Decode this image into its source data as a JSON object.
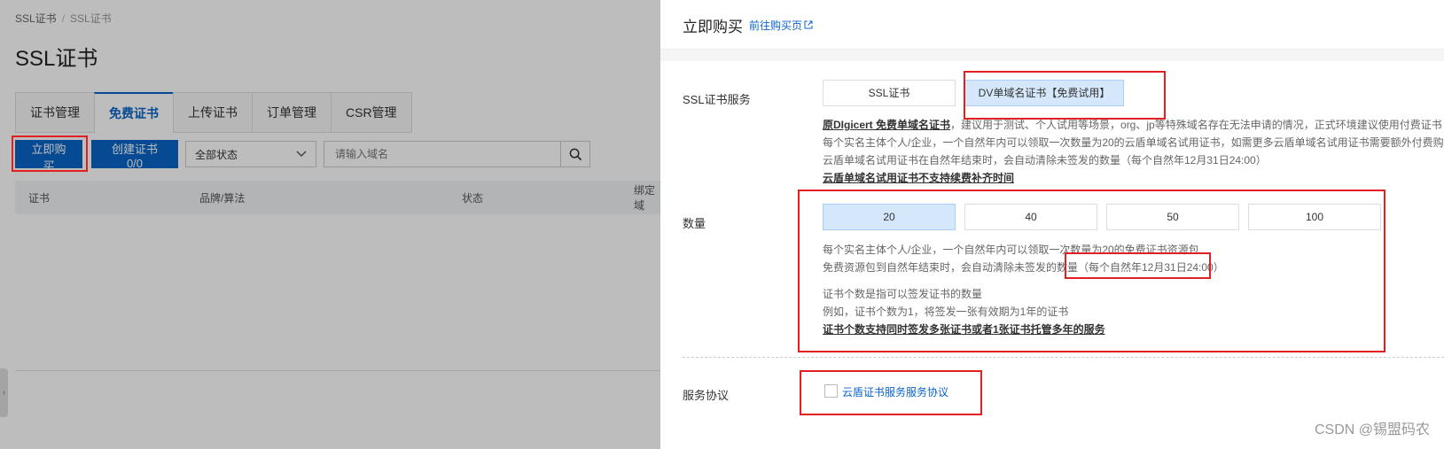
{
  "breadcrumb": [
    "SSL证书",
    "SSL证书"
  ],
  "page_title": "SSL证书",
  "tabs": [
    {
      "label": "证书管理",
      "active": false
    },
    {
      "label": "免费证书",
      "active": true
    },
    {
      "label": "上传证书",
      "active": false
    },
    {
      "label": "订单管理",
      "active": false
    },
    {
      "label": "CSR管理",
      "active": false
    }
  ],
  "toolbar": {
    "buy_label": "立即购买",
    "create_label": "创建证书 0/0",
    "status_select": "全部状态",
    "search_placeholder": "请输入域名"
  },
  "table": {
    "headers": [
      "证书",
      "品牌/算法",
      "状态",
      "绑定域"
    ]
  },
  "drawer": {
    "title": "立即购买",
    "link": "前往购买页",
    "service_label": "SSL证书服务",
    "service_options": [
      {
        "label": "SSL证书",
        "selected": false
      },
      {
        "label": "DV单域名证书【免费试用】",
        "selected": true
      }
    ],
    "service_desc": {
      "line1_bold": "原DIgicert 免费单域名证书",
      "line1_rest": "，建议用于测试、个人试用等场景，org、jp等特殊域名存在无法申请的情况，正式环境建议使用付费证书",
      "line2": "每个实名主体个人/企业，一个自然年内可以领取一次数量为20的云盾单域名试用证书，如需更多云盾单域名试用证书需要额外付费购",
      "line3": "云盾单域名试用证书在自然年结束时，会自动清除未签发的数量（每个自然年12月31日24:00）",
      "line4_bold": "云盾单域名试用证书不支持续费补齐时间"
    },
    "quantity_label": "数量",
    "quantity_options": [
      {
        "label": "20",
        "selected": true
      },
      {
        "label": "40",
        "selected": false
      },
      {
        "label": "50",
        "selected": false
      },
      {
        "label": "100",
        "selected": false
      }
    ],
    "quantity_desc": {
      "line1": "每个实名主体个人/企业，一个自然年内可以领取一次数量为20的免费证书资源包",
      "line2": "免费资源包到自然年结束时，会自动清除未签发的数量（每个自然年12月31日24:00）",
      "line3": "证书个数是指可以签发证书的数量",
      "line4": "例如，证书个数为1，将签发一张有效期为1年的证书",
      "line5_bold": "证书个数支持同时签发多张证书或者1张证书托管多年的服务"
    },
    "agreement_label": "服务协议",
    "agreement_link": "云盾证书服务服务协议"
  },
  "watermark": "CSDN @锡盟码农",
  "colors": {
    "primary": "#0a64c8",
    "highlight": "#e32020",
    "selected_bg": "#d5e7fa"
  }
}
